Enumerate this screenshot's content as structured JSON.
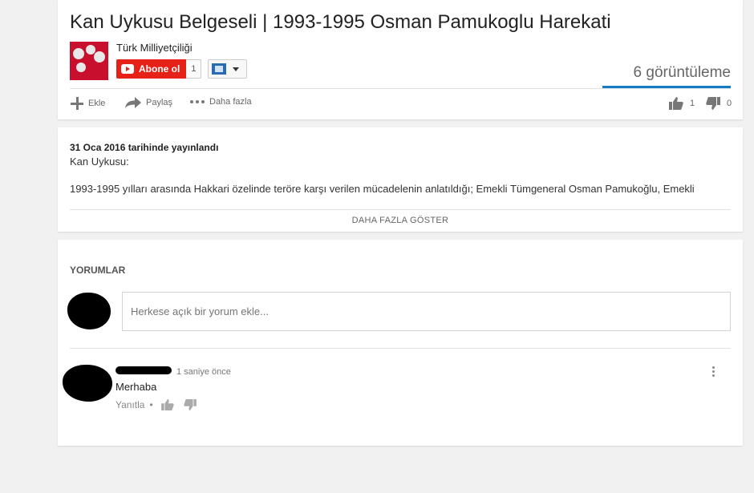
{
  "video": {
    "title": "Kan Uykusu Belgeseli | 1993-1995 Osman Pamukoglu Harekati",
    "views": "6 görüntüleme"
  },
  "channel": {
    "name": "Türk Milliyetçiliği",
    "subscribe_label": "Abone ol",
    "subscriber_count": "1",
    "avatar_text": "Türk Milliyetçiliği"
  },
  "actions": {
    "add_label": "Ekle",
    "share_label": "Paylaş",
    "more_label": "Daha fazla",
    "likes": "1",
    "dislikes": "0"
  },
  "description": {
    "published": "31 Oca 2016 tarihinde yayınlandı",
    "line1": "Kan Uykusu:",
    "line2": "1993-1995 yılları arasında Hakkari özelinde teröre karşı verilen mücadelenin anlatıldığı; Emekli Tümgeneral Osman Pamukoğlu, Emekli",
    "show_more": "DAHA FAZLA GÖSTER"
  },
  "comments": {
    "title": "YORUMLAR",
    "input_placeholder": "Herkese açık bir yorum ekle...",
    "items": [
      {
        "time": "1 saniye önce",
        "text": "Merhaba",
        "reply_label": "Yanıtla",
        "separator": "•"
      }
    ]
  },
  "colors": {
    "accent": "#167ac6",
    "subscribe": "#e62117",
    "background": "#f1f1f1"
  }
}
